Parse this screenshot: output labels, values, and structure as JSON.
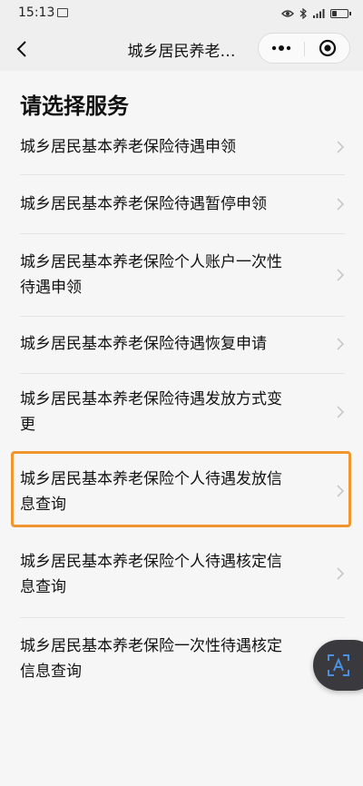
{
  "status_bar": {
    "time": "15:13",
    "battery_level": 0.3
  },
  "nav": {
    "title": "城乡居民养老…",
    "back_icon": "chevron-left-icon",
    "more_icon": "more-dots-icon",
    "close_icon": "target-close-icon"
  },
  "page_title": "请选择服务",
  "services": [
    {
      "line1": "城乡居民基本养老保险待遇申领",
      "line2": ""
    },
    {
      "line1": "城乡居民基本养老保险待遇暂停申领",
      "line2": ""
    },
    {
      "line1": "城乡居民基本养老保险个人账户一次性",
      "line2": "待遇申领"
    },
    {
      "line1": "城乡居民基本养老保险待遇恢复申请",
      "line2": ""
    },
    {
      "line1": "城乡居民基本养老保险待遇发放方式变",
      "line2": "更"
    },
    {
      "line1": "城乡居民基本养老保险个人待遇发放信",
      "line2": "息查询",
      "highlighted": true
    },
    {
      "line1": "城乡居民基本养老保险个人待遇核定信",
      "line2": "息查询"
    },
    {
      "line1": "城乡居民基本养老保险一次性待遇核定",
      "line2": "信息查询"
    }
  ],
  "colors": {
    "highlight": "#f0962e",
    "background": "#f6f6f6",
    "float_button": "#3a3a3e",
    "float_icon": "#4a90e2"
  },
  "float_button": {
    "icon": "text-recognition-icon"
  }
}
